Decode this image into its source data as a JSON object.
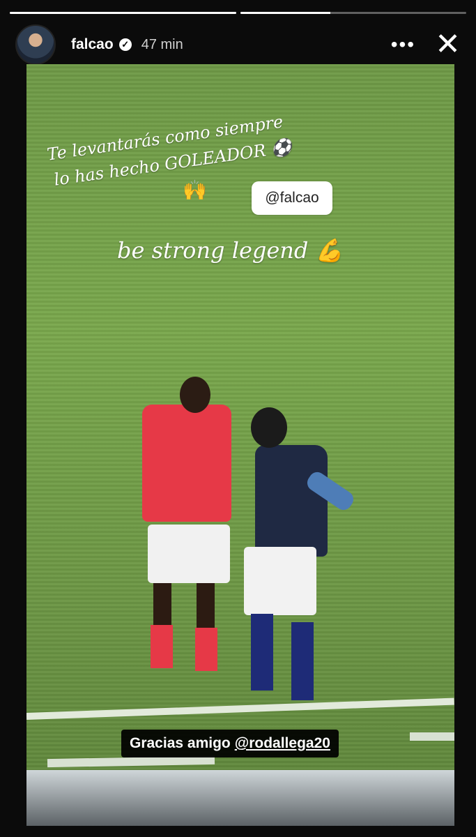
{
  "story": {
    "username": "falcao",
    "time": "47 min",
    "progress_segments": [
      1,
      0.4
    ]
  },
  "overlay": {
    "line1": "Te levantarás como siempre",
    "line2": "lo has hecho GOLEADOR",
    "emoji_ball": "⚽",
    "emoji_hands": "🙌",
    "mention_sticker": "falcao",
    "mention_prefix": "@",
    "line3": "be strong legend",
    "emoji_muscle": "💪"
  },
  "caption": {
    "text": "Gracias amigo",
    "handle_prefix": "@",
    "handle": "rodallega20"
  },
  "icons": {
    "verified": "verified-badge-icon",
    "more": "more-options-icon",
    "close": "close-icon",
    "avatar": "profile-avatar"
  }
}
